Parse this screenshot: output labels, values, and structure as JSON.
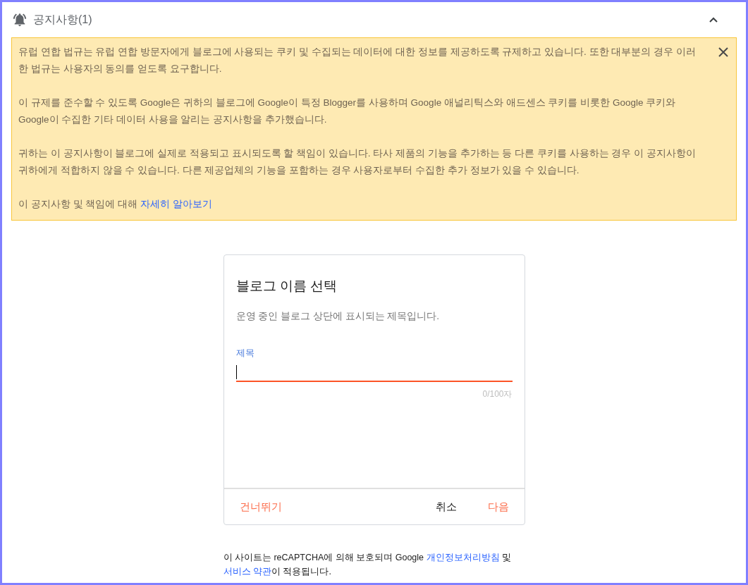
{
  "notice_panel": {
    "title": "공지사항(1)",
    "expanded": true,
    "paragraphs": [
      {
        "text": "유럽 연합 법규는 유럽 연합 방문자에게 블로그에 사용되는 쿠키 및 수집되는 데이터에 대한 정보를 제공하도록 규제하고 있습니다. 또한 대부분의 경우 이러한 법규는 사용자의 동의를 얻도록 요구합니다."
      },
      {
        "text": "이 규제를 준수할 수 있도록 Google은 귀하의 블로그에 Google이 특정 Blogger를 사용하며 Google 애널리틱스와 애드센스 쿠키를 비롯한 Google 쿠키와 Google이 수집한 기타 데이터 사용을 알리는 공지사항을 추가했습니다."
      },
      {
        "text": "귀하는 이 공지사항이 블로그에 실제로 적용되고 표시되도록 할 책임이 있습니다. 타사 제품의 기능을 추가하는 등 다른 쿠키를 사용하는 경우 이 공지사항이 귀하에게 적합하지 않을 수 있습니다. 다른 제공업체의 기능을 포함하는 경우 사용자로부터 수집한 추가 정보가 있을 수 있습니다."
      },
      {
        "parts": [
          {
            "text": "이 공지사항 및 책임에 대해 ",
            "kind": "text"
          },
          {
            "text": "자세히 알아보기",
            "kind": "link"
          }
        ]
      }
    ]
  },
  "dialog": {
    "title": "블로그 이름 선택",
    "description": "운영 중인 블로그 상단에 표시되는 제목입니다.",
    "field": {
      "label": "제목",
      "focused": true,
      "counter": "0/100자"
    },
    "actions": [
      {
        "label": "건너뛰기",
        "kind": "accent"
      },
      {
        "label": "취소",
        "kind": "plain"
      },
      {
        "label": "다음",
        "kind": "accent"
      }
    ]
  },
  "footer": {
    "parts": [
      {
        "text": "이 사이트는 reCAPTCHA에 의해 보호되며 Google ",
        "kind": "text"
      },
      {
        "text": "개인정보처리방침",
        "kind": "link"
      },
      {
        "text": " 및 ",
        "kind": "text"
      },
      {
        "text": "서비스 약관",
        "kind": "link"
      },
      {
        "text": "이 적용됩니다.",
        "kind": "text"
      }
    ]
  }
}
